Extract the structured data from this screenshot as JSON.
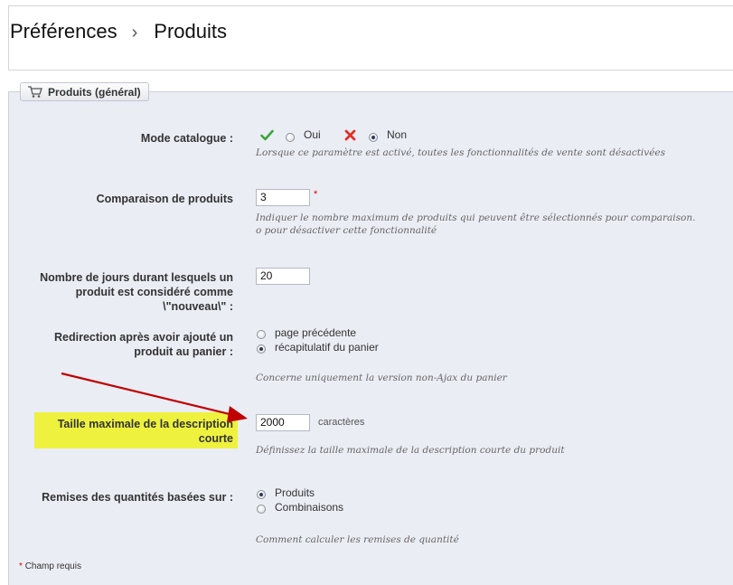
{
  "breadcrumb": {
    "parent": "Préférences",
    "separator": "›",
    "current": "Produits"
  },
  "section": {
    "title": "Produits (général)"
  },
  "fields": {
    "catalog_mode": {
      "label": "Mode catalogue :",
      "yes": "Oui",
      "no": "Non",
      "selected": "Non",
      "hint": "Lorsque ce paramètre est activé, toutes les fonctionnalités de vente sont désactivées"
    },
    "compare": {
      "label": "Comparaison de produits",
      "value": "3",
      "required_mark": "*",
      "hint_line1": "Indiquer le nombre maximum de produits qui peuvent être sélectionnés pour comparaison.",
      "hint_line2": "o pour désactiver cette fonctionnalité"
    },
    "new_days": {
      "label_line1": "Nombre de jours durant lesquels un",
      "label_line2": "produit est considéré comme",
      "label_line3": "\\\"nouveau\\\" :",
      "value": "20"
    },
    "redirect": {
      "label_line1": "Redirection après avoir ajouté un",
      "label_line2": "produit au panier :",
      "option1": "page précédente",
      "option2": "récapitulatif du panier",
      "selected": "récapitulatif du panier",
      "hint": "Concerne uniquement la version non-Ajax du panier"
    },
    "short_desc": {
      "label_line1": "Taille maximale de la description",
      "label_line2": "courte",
      "value": "2000",
      "unit": "caractères",
      "hint": "Définissez la taille maximale de la description courte du produit"
    },
    "discounts": {
      "label": "Remises des quantités basées sur :",
      "option1": "Produits",
      "option2": "Combinaisons",
      "selected": "Produits",
      "hint": "Comment calculer les remises de quantité"
    }
  },
  "footer": {
    "required_star": "*",
    "required_text": "Champ requis"
  },
  "colors": {
    "highlight": "#eef23e",
    "arrow": "#c00000",
    "panel": "#ebedf4"
  },
  "icons": [
    "cart-icon",
    "check-icon",
    "cross-icon",
    "arrow-annotation"
  ]
}
